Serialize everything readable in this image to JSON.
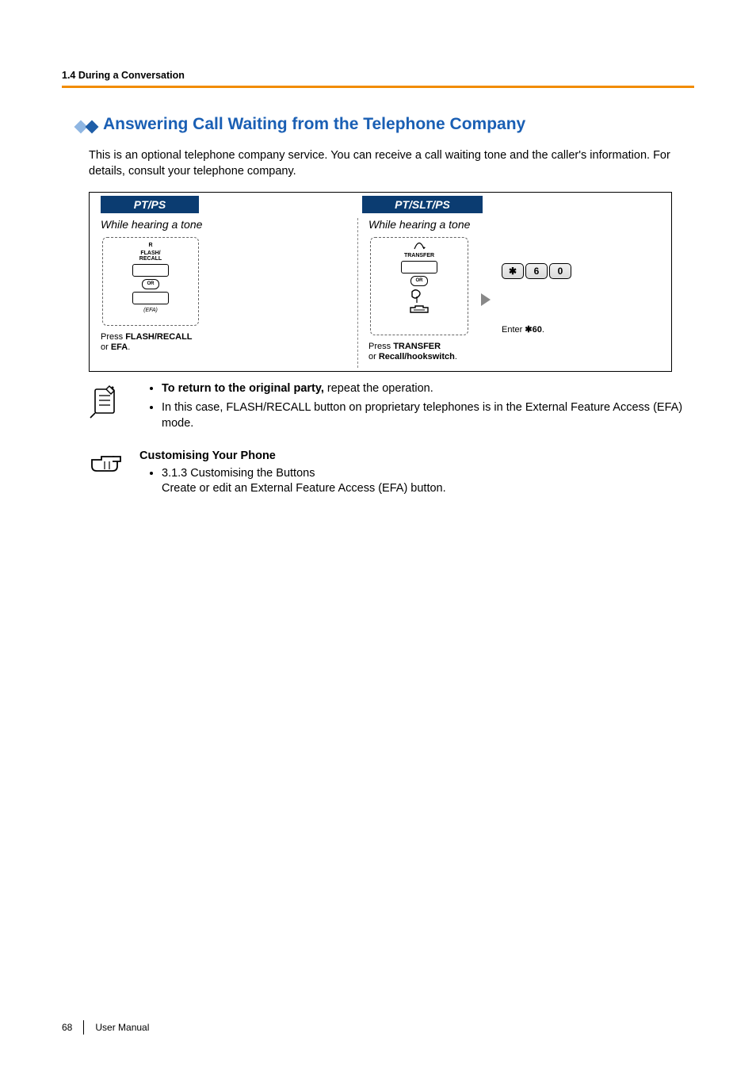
{
  "header": {
    "section_label": "1.4 During a Conversation"
  },
  "title": "Answering Call Waiting from the Telephone Company",
  "intro": "This is an optional telephone company service. You can receive a call waiting tone and the caller's information. For details, consult your telephone company.",
  "diagram": {
    "left_header": "PT/PS",
    "right_header": "PT/SLT/PS",
    "while_tone": "While hearing a tone",
    "left_box": {
      "top_line": "R",
      "flash_label": "FLASH/\nRECALL",
      "or": "OR",
      "efa_label": "(EFA)",
      "caption_prefix": "Press ",
      "caption_bold1": "FLASH/RECALL",
      "caption_mid": "\nor ",
      "caption_bold2": "EFA",
      "caption_suffix": "."
    },
    "right_box": {
      "transfer_label": "TRANSFER",
      "or": "OR",
      "caption_prefix": "Press ",
      "caption_bold1": "TRANSFER",
      "caption_mid": "\nor ",
      "caption_bold2": "Recall/hookswitch",
      "caption_suffix": "."
    },
    "dial": {
      "keys": [
        "",
        "6",
        "0"
      ],
      "star_glyph": "✱",
      "caption_prefix": "Enter ",
      "caption_bold": "✱60",
      "caption_suffix": "."
    }
  },
  "notes": {
    "bullet1_bold": "To return to the original party,",
    "bullet1_rest": " repeat the operation.",
    "bullet2": "In this case, FLASH/RECALL button on proprietary telephones is in the External Feature Access (EFA) mode."
  },
  "custom": {
    "heading": "Customising Your Phone",
    "bullet_ref": "3.1.3 Customising the Buttons",
    "bullet_desc": "Create or edit an External Feature Access (EFA) button."
  },
  "footer": {
    "page": "68",
    "label": "User Manual"
  }
}
